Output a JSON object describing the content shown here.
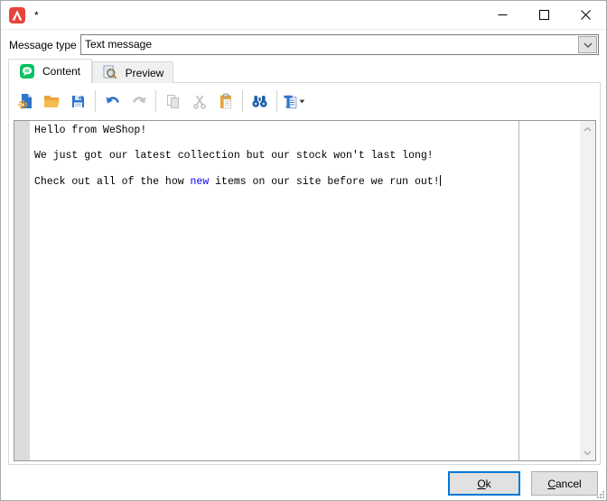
{
  "window": {
    "title": "*",
    "app_icon": "red-a-app-icon",
    "controls": [
      "minimize-icon",
      "maximize-icon",
      "close-icon"
    ]
  },
  "message_type": {
    "label": "Message type",
    "value": "Text message"
  },
  "tabs": [
    {
      "label": "Content",
      "icon": "chat-bubble-icon",
      "active": true
    },
    {
      "label": "Preview",
      "icon": "preview-magnifier-icon",
      "active": false
    }
  ],
  "toolbar": [
    {
      "name": "new-from-template",
      "icon": "page-gear-icon",
      "enabled": true,
      "group": 1
    },
    {
      "name": "open",
      "icon": "open-folder-icon",
      "enabled": true,
      "group": 1
    },
    {
      "name": "save",
      "icon": "save-floppy-icon",
      "enabled": true,
      "group": 1
    },
    {
      "name": "undo",
      "icon": "undo-arrow-icon",
      "enabled": true,
      "group": 2
    },
    {
      "name": "redo",
      "icon": "redo-arrow-icon",
      "enabled": false,
      "group": 2
    },
    {
      "name": "copy",
      "icon": "copy-pages-icon",
      "enabled": false,
      "group": 3
    },
    {
      "name": "cut",
      "icon": "cut-scissors-icon",
      "enabled": false,
      "group": 3
    },
    {
      "name": "paste",
      "icon": "paste-clipboard-icon",
      "enabled": true,
      "group": 3
    },
    {
      "name": "find",
      "icon": "binoculars-icon",
      "enabled": true,
      "group": 4
    },
    {
      "name": "insert-template",
      "icon": "template-text-icon",
      "enabled": true,
      "group": 5,
      "has_dropdown": true
    }
  ],
  "editor": {
    "text_color": "#000000",
    "highlight_color": "#0000ff",
    "lines": [
      {
        "segments": [
          {
            "text": "Hello from WeShop!"
          }
        ]
      },
      {
        "segments": []
      },
      {
        "segments": [
          {
            "text": "We just got our latest collection but our stock won't last long!"
          }
        ]
      },
      {
        "segments": []
      },
      {
        "segments": [
          {
            "text": "Check out all of the how "
          },
          {
            "text": "new",
            "color": "#0000ff"
          },
          {
            "text": " items on our site before we run out!"
          }
        ],
        "caret_at_end": true
      }
    ]
  },
  "footer": {
    "ok": "Ok",
    "cancel": "Cancel"
  },
  "colors": {
    "accent_blue": "#0078d7",
    "icon_blue": "#2e74c9",
    "icon_orange": "#eda43b",
    "chat_green": "#07c160",
    "app_red": "#e8433a",
    "highlight_text": "#0000ff"
  }
}
